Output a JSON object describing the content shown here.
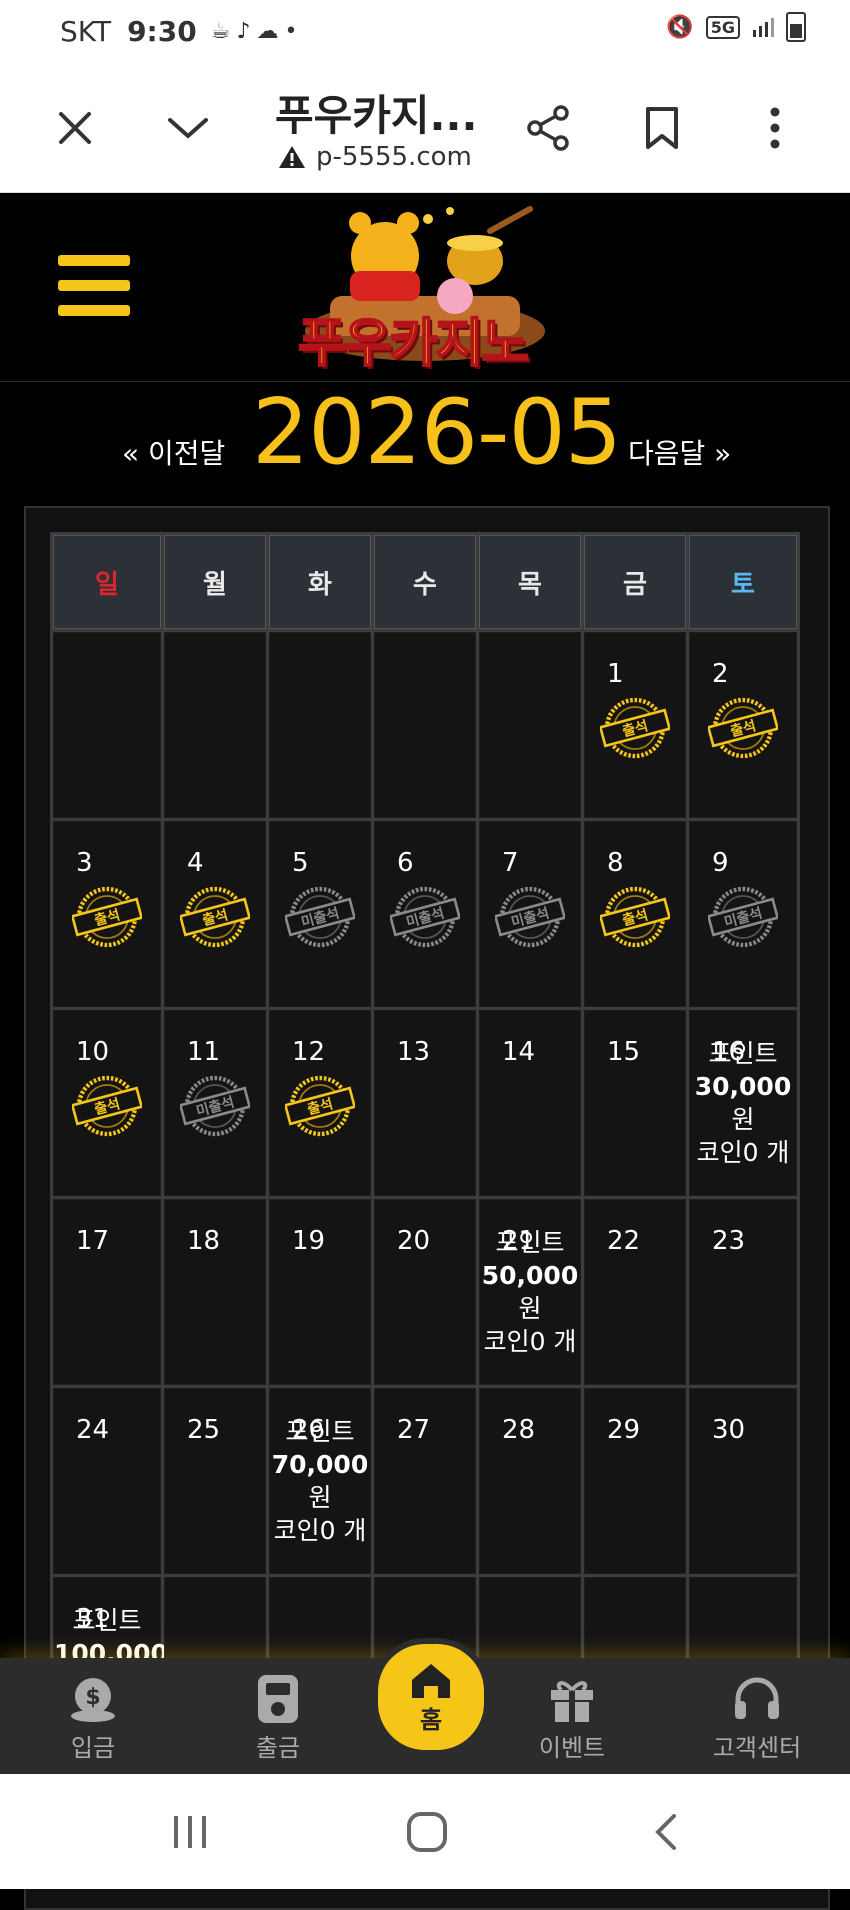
{
  "status_bar": {
    "carrier": "SKT",
    "time": "9:30",
    "network": "5G"
  },
  "browser": {
    "title": "푸우카지...",
    "url": "p-5555.com"
  },
  "site": {
    "logo_text": "푸우카지노"
  },
  "month_nav": {
    "prev": "« 이전달",
    "month": "2026-05",
    "next": "다음달 »"
  },
  "weekdays": [
    "일",
    "월",
    "화",
    "수",
    "목",
    "금",
    "토"
  ],
  "colors": {
    "sunday": "#e0242b",
    "saturday": "#5ab7f0",
    "accent": "#f5c518"
  },
  "stamps": {
    "attend": "출석",
    "absent": "미출석"
  },
  "reward_labels": {
    "point": "포인트",
    "won": "원",
    "coin": "코인0 개"
  },
  "calendar_rows": [
    [
      {
        "day": "",
        "status": ""
      },
      {
        "day": "",
        "status": ""
      },
      {
        "day": "",
        "status": ""
      },
      {
        "day": "",
        "status": ""
      },
      {
        "day": "",
        "status": ""
      },
      {
        "day": "1",
        "status": "attend"
      },
      {
        "day": "2",
        "status": "attend"
      }
    ],
    [
      {
        "day": "3",
        "status": "attend"
      },
      {
        "day": "4",
        "status": "attend"
      },
      {
        "day": "5",
        "status": "absent"
      },
      {
        "day": "6",
        "status": "absent"
      },
      {
        "day": "7",
        "status": "absent"
      },
      {
        "day": "8",
        "status": "attend"
      },
      {
        "day": "9",
        "status": "absent"
      }
    ],
    [
      {
        "day": "10",
        "status": "attend"
      },
      {
        "day": "11",
        "status": "absent"
      },
      {
        "day": "12",
        "status": "attend"
      },
      {
        "day": "13",
        "status": ""
      },
      {
        "day": "14",
        "status": ""
      },
      {
        "day": "15",
        "status": ""
      },
      {
        "day": "16",
        "status": "",
        "reward": "30,000"
      }
    ],
    [
      {
        "day": "17",
        "status": ""
      },
      {
        "day": "18",
        "status": ""
      },
      {
        "day": "19",
        "status": ""
      },
      {
        "day": "20",
        "status": ""
      },
      {
        "day": "21",
        "status": "",
        "reward": "50,000"
      },
      {
        "day": "22",
        "status": ""
      },
      {
        "day": "23",
        "status": ""
      }
    ],
    [
      {
        "day": "24",
        "status": ""
      },
      {
        "day": "25",
        "status": ""
      },
      {
        "day": "26",
        "status": "",
        "reward": "70,000"
      },
      {
        "day": "27",
        "status": ""
      },
      {
        "day": "28",
        "status": ""
      },
      {
        "day": "29",
        "status": ""
      },
      {
        "day": "30",
        "status": ""
      }
    ],
    [
      {
        "day": "31",
        "status": "",
        "reward": "100,000"
      },
      {
        "day": "",
        "status": ""
      },
      {
        "day": "",
        "status": ""
      },
      {
        "day": "",
        "status": ""
      },
      {
        "day": "",
        "status": ""
      },
      {
        "day": "",
        "status": ""
      },
      {
        "day": "",
        "status": ""
      }
    ]
  ],
  "bottom_nav": {
    "deposit": "입금",
    "withdraw": "출금",
    "home": "홈",
    "event": "이벤트",
    "support": "고객센터"
  }
}
